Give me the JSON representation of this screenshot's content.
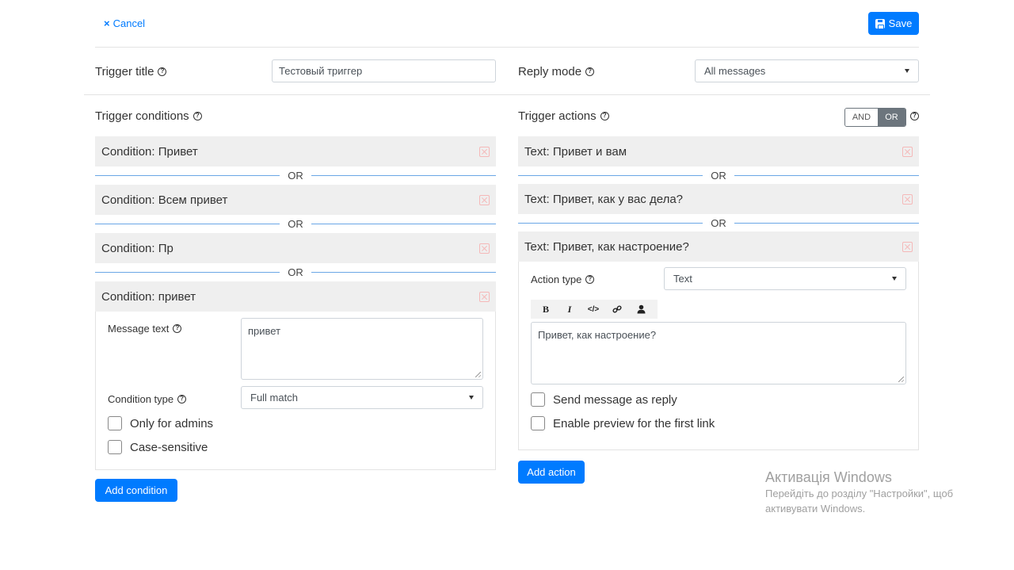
{
  "toolbar": {
    "cancel_label": "Cancel",
    "save_label": "Save"
  },
  "trigger": {
    "title_label": "Trigger title",
    "title_value": "Тестовый триггер",
    "reply_mode_label": "Reply mode",
    "reply_mode_value": "All messages"
  },
  "conditions": {
    "heading": "Trigger conditions",
    "separator": "OR",
    "items": [
      {
        "label": "Condition: Привет"
      },
      {
        "label": "Condition: Всем привет"
      },
      {
        "label": "Condition: Пр"
      },
      {
        "label": "Condition: привет"
      }
    ],
    "expanded": {
      "message_text_label": "Message text",
      "message_text_value": "привет",
      "condition_type_label": "Condition type",
      "condition_type_value": "Full match",
      "only_admins_label": "Only for admins",
      "case_sensitive_label": "Case-sensitive"
    },
    "add_label": "Add condition"
  },
  "actions": {
    "heading": "Trigger actions",
    "toggle_and": "AND",
    "toggle_or": "OR",
    "separator": "OR",
    "items": [
      {
        "label": "Text: Привет и вам"
      },
      {
        "label": "Text: Привет, как у вас дела?"
      },
      {
        "label": "Text: Привет, как настроение?"
      }
    ],
    "expanded": {
      "action_type_label": "Action type",
      "action_type_value": "Text",
      "editor_buttons": [
        "B",
        "I",
        "</>"
      ],
      "editor_value": "Привет, как настроение?",
      "send_as_reply_label": "Send message as reply",
      "enable_preview_label": "Enable preview for the first link"
    },
    "add_label": "Add action"
  },
  "watermark": {
    "title": "Активація Windows",
    "line1": "Перейдіть до розділу \"Настройки\", щоб",
    "line2": "активувати Windows."
  },
  "colors": {
    "primary": "#007bff",
    "row_bg": "#efefef",
    "separator_line": "#6aa7e6",
    "remove_icon": "#f5b8b8"
  }
}
